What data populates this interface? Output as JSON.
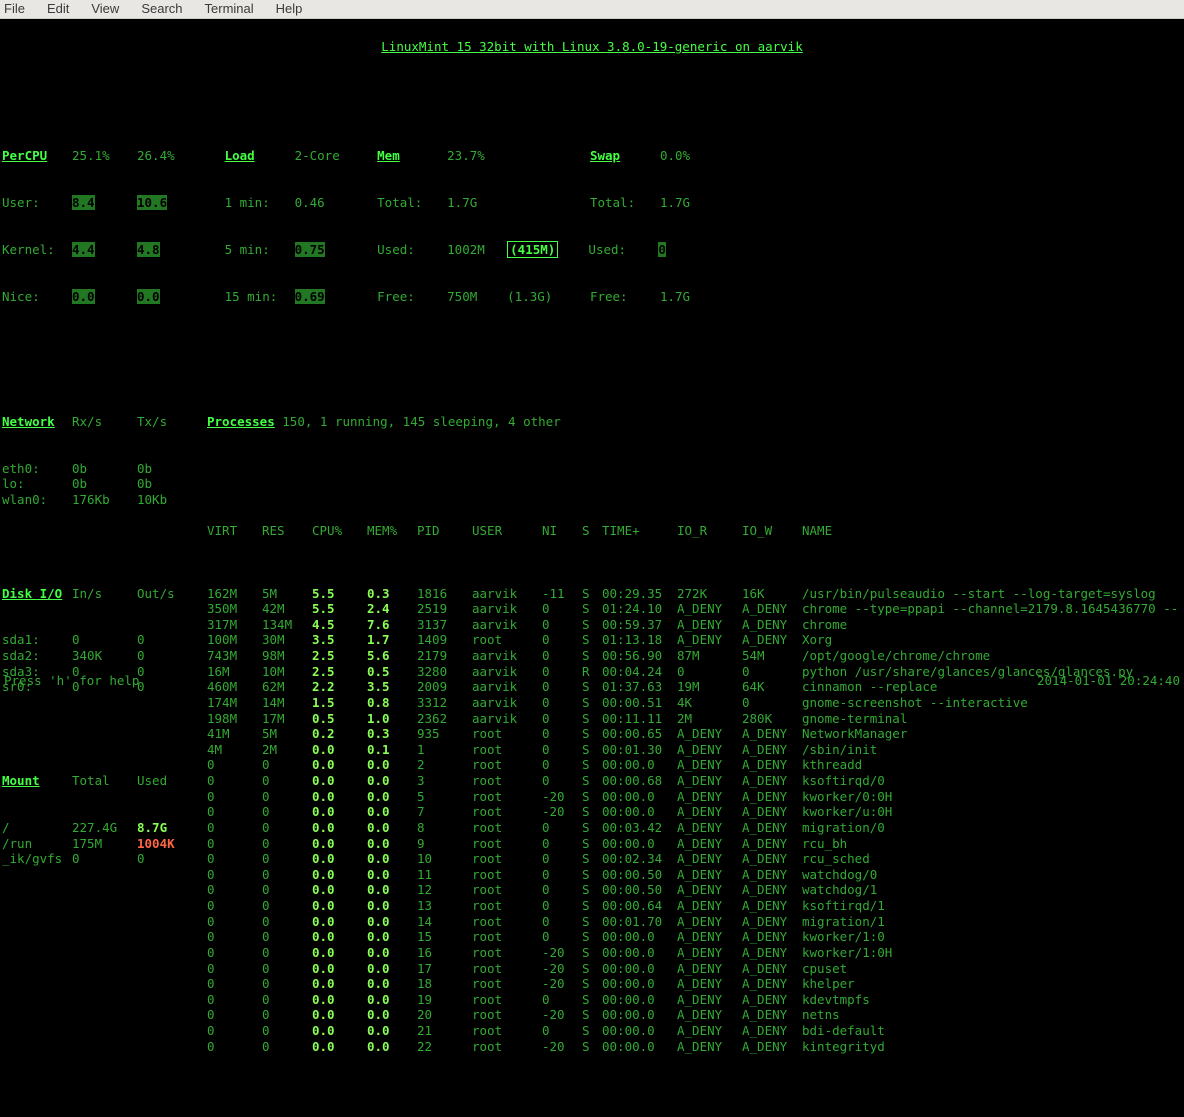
{
  "menubar": [
    "File",
    "Edit",
    "View",
    "Search",
    "Terminal",
    "Help"
  ],
  "title": "LinuxMint 15 32bit with Linux 3.8.0-19-generic on aarvik",
  "percpu": {
    "header": "PerCPU",
    "total": "25.1%",
    "core2": "26.4%",
    "user_lbl": "User:",
    "user1": "8.4",
    "user2": "10.6",
    "kernel_lbl": "Kernel:",
    "kernel1": "4.4",
    "kernel2": "4.8",
    "nice_lbl": "Nice:",
    "nice1": "0.0",
    "nice2": "0.0"
  },
  "load": {
    "header": "Load",
    "cores": "2-Core",
    "l1": "1 min:",
    "v1": "0.46",
    "l5": "5 min:",
    "v5": "0.75",
    "l15": "15 min:",
    "v15": "0.69"
  },
  "mem": {
    "header": "Mem",
    "pct": "23.7%",
    "total_lbl": "Total:",
    "total": "1.7G",
    "used_lbl": "Used:",
    "used": "1002M",
    "active": "(415M)",
    "free_lbl": "Free:",
    "free": "750M",
    "inactive": "(1.3G)"
  },
  "swap": {
    "header": "Swap",
    "pct": "0.0%",
    "total_lbl": "Total:",
    "total": "1.7G",
    "used_lbl": "Used:",
    "used": "0",
    "free_lbl": "Free:",
    "free": "1.7G"
  },
  "network": {
    "header": "Network",
    "rx": "Rx/s",
    "tx": "Tx/s",
    "rows": [
      {
        "if": "eth0:",
        "rx": "0b",
        "tx": "0b"
      },
      {
        "if": "lo:",
        "rx": "0b",
        "tx": "0b"
      },
      {
        "if": "wlan0:",
        "rx": "176Kb",
        "tx": "10Kb"
      }
    ]
  },
  "diskio": {
    "header": "Disk I/O",
    "in": "In/s",
    "out": "Out/s",
    "rows": [
      {
        "d": "sda1:",
        "i": "0",
        "o": "0"
      },
      {
        "d": "sda2:",
        "i": "340K",
        "o": "0"
      },
      {
        "d": "sda3:",
        "i": "0",
        "o": "0"
      },
      {
        "d": "sr0:",
        "i": "0",
        "o": "0"
      }
    ]
  },
  "mount": {
    "header": "Mount",
    "total": "Total",
    "used": "Used",
    "rows": [
      {
        "m": "/",
        "t": "227.4G",
        "u": "8.7G",
        "hl": true
      },
      {
        "m": "/run",
        "t": "175M",
        "u": "1004K",
        "red": true
      },
      {
        "m": "_ik/gvfs",
        "t": "0",
        "u": "0"
      }
    ]
  },
  "proc_header": {
    "label": "Processes",
    "summary": "150, 1 running, 145 sleeping, 4 other"
  },
  "cols": {
    "virt": "VIRT",
    "res": "RES",
    "cpu": "CPU%",
    "mem": "MEM%",
    "pid": "PID",
    "user": "USER",
    "ni": "NI",
    "s": "S",
    "time": "TIME+",
    "ior": "IO_R",
    "iow": "IO_W",
    "name": "NAME"
  },
  "procs": [
    {
      "virt": "162M",
      "res": "5M",
      "cpu": "5.5",
      "mem": "0.3",
      "pid": "1816",
      "user": "aarvik",
      "ni": "-11",
      "s": "S",
      "time": "00:29.35",
      "ior": "272K",
      "iow": "16K",
      "name": "/usr/bin/pulseaudio --start --log-target=syslog"
    },
    {
      "virt": "350M",
      "res": "42M",
      "cpu": "5.5",
      "mem": "2.4",
      "pid": "2519",
      "user": "aarvik",
      "ni": "0",
      "s": "S",
      "time": "01:24.10",
      "ior": "A_DENY",
      "iow": "A_DENY",
      "name": "chrome --type=ppapi --channel=2179.8.1645436770 --"
    },
    {
      "virt": "317M",
      "res": "134M",
      "cpu": "4.5",
      "mem": "7.6",
      "pid": "3137",
      "user": "aarvik",
      "ni": "0",
      "s": "S",
      "time": "00:59.37",
      "ior": "A_DENY",
      "iow": "A_DENY",
      "name": "chrome"
    },
    {
      "virt": "100M",
      "res": "30M",
      "cpu": "3.5",
      "mem": "1.7",
      "pid": "1409",
      "user": "root",
      "ni": "0",
      "s": "S",
      "time": "01:13.18",
      "ior": "A_DENY",
      "iow": "A_DENY",
      "name": "Xorg"
    },
    {
      "virt": "743M",
      "res": "98M",
      "cpu": "2.5",
      "mem": "5.6",
      "pid": "2179",
      "user": "aarvik",
      "ni": "0",
      "s": "S",
      "time": "00:56.90",
      "ior": "87M",
      "iow": "54M",
      "name": "/opt/google/chrome/chrome"
    },
    {
      "virt": "16M",
      "res": "10M",
      "cpu": "2.5",
      "mem": "0.5",
      "pid": "3280",
      "user": "aarvik",
      "ni": "0",
      "s": "R",
      "time": "00:04.24",
      "ior": "0",
      "iow": "0",
      "name": "python /usr/share/glances/glances/glances.py"
    },
    {
      "virt": "460M",
      "res": "62M",
      "cpu": "2.2",
      "mem": "3.5",
      "pid": "2009",
      "user": "aarvik",
      "ni": "0",
      "s": "S",
      "time": "01:37.63",
      "ior": "19M",
      "iow": "64K",
      "name": "cinnamon --replace"
    },
    {
      "virt": "174M",
      "res": "14M",
      "cpu": "1.5",
      "mem": "0.8",
      "pid": "3312",
      "user": "aarvik",
      "ni": "0",
      "s": "S",
      "time": "00:00.51",
      "ior": "4K",
      "iow": "0",
      "name": "gnome-screenshot --interactive"
    },
    {
      "virt": "198M",
      "res": "17M",
      "cpu": "0.5",
      "mem": "1.0",
      "pid": "2362",
      "user": "aarvik",
      "ni": "0",
      "s": "S",
      "time": "00:11.11",
      "ior": "2M",
      "iow": "280K",
      "name": "gnome-terminal"
    },
    {
      "virt": "41M",
      "res": "5M",
      "cpu": "0.2",
      "mem": "0.3",
      "pid": "935",
      "user": "root",
      "ni": "0",
      "s": "S",
      "time": "00:00.65",
      "ior": "A_DENY",
      "iow": "A_DENY",
      "name": "NetworkManager"
    },
    {
      "virt": "4M",
      "res": "2M",
      "cpu": "0.0",
      "mem": "0.1",
      "pid": "1",
      "user": "root",
      "ni": "0",
      "s": "S",
      "time": "00:01.30",
      "ior": "A_DENY",
      "iow": "A_DENY",
      "name": "/sbin/init"
    },
    {
      "virt": "0",
      "res": "0",
      "cpu": "0.0",
      "mem": "0.0",
      "pid": "2",
      "user": "root",
      "ni": "0",
      "s": "S",
      "time": "00:00.0",
      "ior": "A_DENY",
      "iow": "A_DENY",
      "name": "kthreadd"
    },
    {
      "virt": "0",
      "res": "0",
      "cpu": "0.0",
      "mem": "0.0",
      "pid": "3",
      "user": "root",
      "ni": "0",
      "s": "S",
      "time": "00:00.68",
      "ior": "A_DENY",
      "iow": "A_DENY",
      "name": "ksoftirqd/0"
    },
    {
      "virt": "0",
      "res": "0",
      "cpu": "0.0",
      "mem": "0.0",
      "pid": "5",
      "user": "root",
      "ni": "-20",
      "s": "S",
      "time": "00:00.0",
      "ior": "A_DENY",
      "iow": "A_DENY",
      "name": "kworker/0:0H"
    },
    {
      "virt": "0",
      "res": "0",
      "cpu": "0.0",
      "mem": "0.0",
      "pid": "7",
      "user": "root",
      "ni": "-20",
      "s": "S",
      "time": "00:00.0",
      "ior": "A_DENY",
      "iow": "A_DENY",
      "name": "kworker/u:0H"
    },
    {
      "virt": "0",
      "res": "0",
      "cpu": "0.0",
      "mem": "0.0",
      "pid": "8",
      "user": "root",
      "ni": "0",
      "s": "S",
      "time": "00:03.42",
      "ior": "A_DENY",
      "iow": "A_DENY",
      "name": "migration/0"
    },
    {
      "virt": "0",
      "res": "0",
      "cpu": "0.0",
      "mem": "0.0",
      "pid": "9",
      "user": "root",
      "ni": "0",
      "s": "S",
      "time": "00:00.0",
      "ior": "A_DENY",
      "iow": "A_DENY",
      "name": "rcu_bh"
    },
    {
      "virt": "0",
      "res": "0",
      "cpu": "0.0",
      "mem": "0.0",
      "pid": "10",
      "user": "root",
      "ni": "0",
      "s": "S",
      "time": "00:02.34",
      "ior": "A_DENY",
      "iow": "A_DENY",
      "name": "rcu_sched"
    },
    {
      "virt": "0",
      "res": "0",
      "cpu": "0.0",
      "mem": "0.0",
      "pid": "11",
      "user": "root",
      "ni": "0",
      "s": "S",
      "time": "00:00.50",
      "ior": "A_DENY",
      "iow": "A_DENY",
      "name": "watchdog/0"
    },
    {
      "virt": "0",
      "res": "0",
      "cpu": "0.0",
      "mem": "0.0",
      "pid": "12",
      "user": "root",
      "ni": "0",
      "s": "S",
      "time": "00:00.50",
      "ior": "A_DENY",
      "iow": "A_DENY",
      "name": "watchdog/1"
    },
    {
      "virt": "0",
      "res": "0",
      "cpu": "0.0",
      "mem": "0.0",
      "pid": "13",
      "user": "root",
      "ni": "0",
      "s": "S",
      "time": "00:00.64",
      "ior": "A_DENY",
      "iow": "A_DENY",
      "name": "ksoftirqd/1"
    },
    {
      "virt": "0",
      "res": "0",
      "cpu": "0.0",
      "mem": "0.0",
      "pid": "14",
      "user": "root",
      "ni": "0",
      "s": "S",
      "time": "00:01.70",
      "ior": "A_DENY",
      "iow": "A_DENY",
      "name": "migration/1"
    },
    {
      "virt": "0",
      "res": "0",
      "cpu": "0.0",
      "mem": "0.0",
      "pid": "15",
      "user": "root",
      "ni": "0",
      "s": "S",
      "time": "00:00.0",
      "ior": "A_DENY",
      "iow": "A_DENY",
      "name": "kworker/1:0"
    },
    {
      "virt": "0",
      "res": "0",
      "cpu": "0.0",
      "mem": "0.0",
      "pid": "16",
      "user": "root",
      "ni": "-20",
      "s": "S",
      "time": "00:00.0",
      "ior": "A_DENY",
      "iow": "A_DENY",
      "name": "kworker/1:0H"
    },
    {
      "virt": "0",
      "res": "0",
      "cpu": "0.0",
      "mem": "0.0",
      "pid": "17",
      "user": "root",
      "ni": "-20",
      "s": "S",
      "time": "00:00.0",
      "ior": "A_DENY",
      "iow": "A_DENY",
      "name": "cpuset"
    },
    {
      "virt": "0",
      "res": "0",
      "cpu": "0.0",
      "mem": "0.0",
      "pid": "18",
      "user": "root",
      "ni": "-20",
      "s": "S",
      "time": "00:00.0",
      "ior": "A_DENY",
      "iow": "A_DENY",
      "name": "khelper"
    },
    {
      "virt": "0",
      "res": "0",
      "cpu": "0.0",
      "mem": "0.0",
      "pid": "19",
      "user": "root",
      "ni": "0",
      "s": "S",
      "time": "00:00.0",
      "ior": "A_DENY",
      "iow": "A_DENY",
      "name": "kdevtmpfs"
    },
    {
      "virt": "0",
      "res": "0",
      "cpu": "0.0",
      "mem": "0.0",
      "pid": "20",
      "user": "root",
      "ni": "-20",
      "s": "S",
      "time": "00:00.0",
      "ior": "A_DENY",
      "iow": "A_DENY",
      "name": "netns"
    },
    {
      "virt": "0",
      "res": "0",
      "cpu": "0.0",
      "mem": "0.0",
      "pid": "21",
      "user": "root",
      "ni": "0",
      "s": "S",
      "time": "00:00.0",
      "ior": "A_DENY",
      "iow": "A_DENY",
      "name": "bdi-default"
    },
    {
      "virt": "0",
      "res": "0",
      "cpu": "0.0",
      "mem": "0.0",
      "pid": "22",
      "user": "root",
      "ni": "-20",
      "s": "S",
      "time": "00:00.0",
      "ior": "A_DENY",
      "iow": "A_DENY",
      "name": "kintegrityd"
    }
  ],
  "footer": {
    "help": "Press 'h' for help",
    "clock": "2014-01-01 20:24:40"
  }
}
